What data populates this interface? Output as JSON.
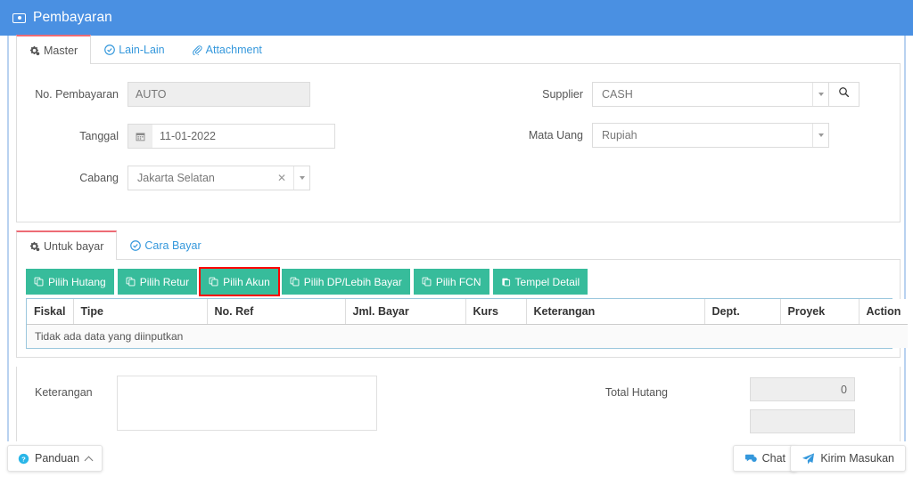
{
  "titlebar": {
    "icon": "banknote-icon",
    "title": "Pembayaran"
  },
  "master_tabs": [
    {
      "label": "Master",
      "icon": "gears-icon",
      "active": true
    },
    {
      "label": "Lain-Lain",
      "icon": "check-circle-icon",
      "active": false
    },
    {
      "label": "Attachment",
      "icon": "paperclip-icon",
      "active": false
    }
  ],
  "master_form": {
    "no_pembayaran": {
      "label": "No. Pembayaran",
      "value": "AUTO",
      "readonly": true
    },
    "tanggal": {
      "label": "Tanggal",
      "value": "11-01-2022",
      "icon": "calendar-icon"
    },
    "cabang": {
      "label": "Cabang",
      "value": "Jakarta Selatan",
      "clear_icon": "close-x-icon",
      "caret_icon": "caret-down-icon"
    },
    "supplier": {
      "label": "Supplier",
      "value": "CASH",
      "caret_icon": "caret-down-icon",
      "search_icon": "search-icon"
    },
    "mata_uang": {
      "label": "Mata Uang",
      "value": "Rupiah",
      "caret_icon": "caret-down-icon"
    }
  },
  "detail_tabs": [
    {
      "label": "Untuk bayar",
      "icon": "gears-icon",
      "active": true
    },
    {
      "label": "Cara Bayar",
      "icon": "check-circle-icon",
      "active": false
    }
  ],
  "toolbar": {
    "buttons": [
      {
        "label": "Pilih Hutang",
        "icon": "copy-icon",
        "highlighted": false
      },
      {
        "label": "Pilih Retur",
        "icon": "copy-icon",
        "highlighted": false
      },
      {
        "label": "Pilih Akun",
        "icon": "copy-icon",
        "highlighted": true
      },
      {
        "label": "Pilih DP/Lebih Bayar",
        "icon": "copy-icon",
        "highlighted": false
      },
      {
        "label": "Pilih FCN",
        "icon": "copy-icon",
        "highlighted": false
      },
      {
        "label": "Tempel Detail",
        "icon": "paste-icon",
        "highlighted": false
      }
    ],
    "highlight_color": "#ff0000",
    "button_color": "#37bc9b"
  },
  "grid": {
    "columns": [
      "Fiskal",
      "Tipe",
      "No. Ref",
      "Jml. Bayar",
      "Kurs",
      "Keterangan",
      "Dept.",
      "Proyek",
      "Action"
    ],
    "empty_message": "Tidak ada data yang diinputkan",
    "rows": []
  },
  "footer": {
    "keterangan_label": "Keterangan",
    "keterangan_value": "",
    "keterangan_placeholder": "",
    "total_hutang_label": "Total Hutang",
    "total_hutang_value": "0"
  },
  "bottom_bar": {
    "panduan": {
      "label": "Panduan",
      "icon": "question-circle-icon",
      "chevron": "chevron-up-icon"
    },
    "chat": {
      "label": "Chat",
      "icon": "chat-bubble-icon"
    },
    "kirim_masukan": {
      "label": "Kirim Masukan",
      "icon": "paper-plane-icon"
    }
  },
  "colors": {
    "header_blue": "#4a90e2",
    "teal": "#37bc9b",
    "link_blue": "#3598dc",
    "active_tab_border": "#ed6b75"
  }
}
